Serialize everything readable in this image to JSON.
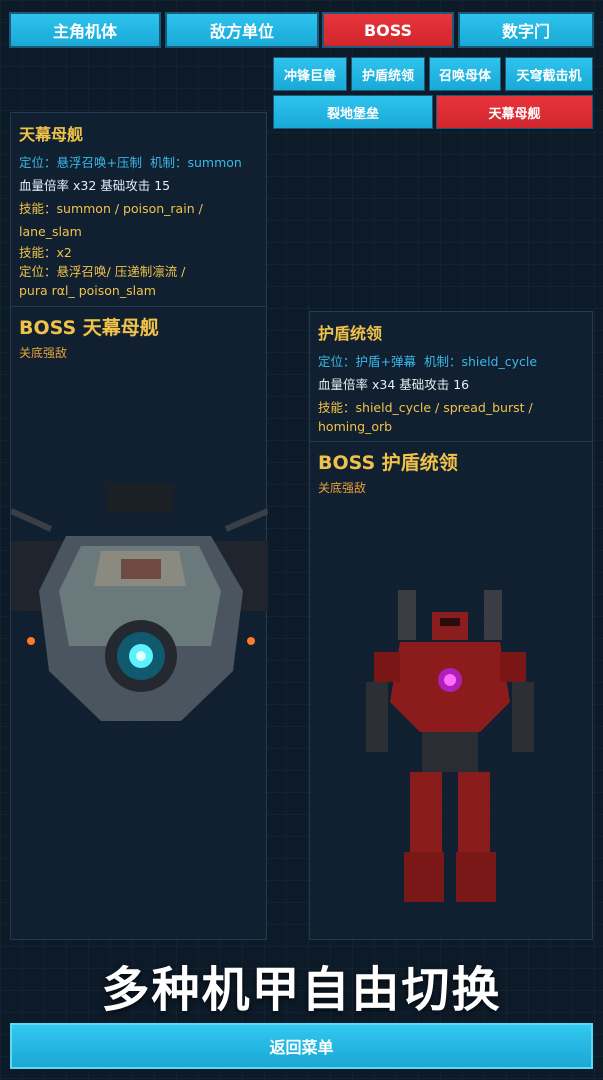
{
  "tabs": [
    {
      "label": "主角机体"
    },
    {
      "label": "敌方单位"
    },
    {
      "label": "BOSS"
    },
    {
      "label": "数字门"
    }
  ],
  "subtabs": [
    {
      "label": "冲锋巨兽"
    },
    {
      "label": "护盾统领"
    },
    {
      "label": "召唤母体"
    },
    {
      "label": "天穹截击机"
    },
    {
      "label": "裂地堡垒"
    },
    {
      "label": "天幕母舰"
    }
  ],
  "left": {
    "name": "天幕母舰",
    "role_label": "定位：",
    "role": "悬浮召唤+压制",
    "mech_label": "机制：",
    "mech": "summon",
    "stats": "血量倍率 x32   基础攻击 15",
    "skills_label": "技能：",
    "skills": "summon / poison_rain / lane_slam",
    "skills2_label": "技能：",
    "skills2": "x2",
    "role2_label": "定位：",
    "role2": "悬浮召唤/ 压递制凛流 /",
    "role2_cont": "pura rαl_ poison_slam",
    "boss_title": "BOSS 天幕母舰",
    "boss_sub": "关底强敌"
  },
  "right": {
    "name": "护盾统领",
    "role_label": "定位：",
    "role": "护盾+弹幕",
    "mech_label": "机制：",
    "mech": "shield_cycle",
    "stats": "血量倍率 x34   基础攻击 16",
    "skills_label": "技能：",
    "skills": "shield_cycle / spread_burst /",
    "skills_cont": "homing_orb",
    "boss_title": "BOSS 护盾统领",
    "boss_sub": "关底强敌"
  },
  "headline": "多种机甲自由切换",
  "menu_button": "返回菜单"
}
